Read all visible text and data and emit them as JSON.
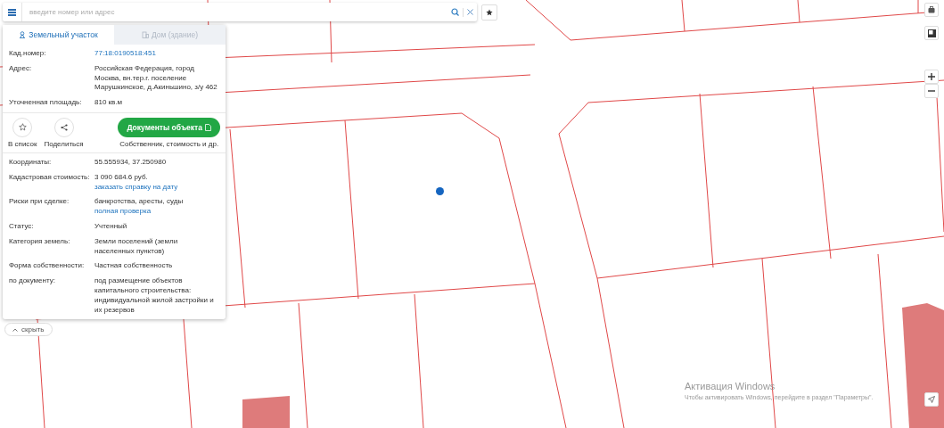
{
  "search": {
    "placeholder": "введите номер или адрес"
  },
  "tabs": [
    {
      "label": "Земельный участок",
      "selected": true
    },
    {
      "label": "Дом (здание)",
      "selected": false
    }
  ],
  "info_top": [
    {
      "label": "Кад.номер:",
      "value": "77:18:0190518:451",
      "kind": "link"
    },
    {
      "label": "Адрес:",
      "value": "Российская Федерация, город Москва, вн.тер.г. поселение Марушкинское, д.Акиньшино, з/у 462",
      "kind": "text"
    },
    {
      "label": "Уточненная площадь:",
      "value": "810 кв.м",
      "kind": "text"
    }
  ],
  "actions": {
    "favorite": "В список",
    "share": "Поделиться",
    "documents_button": "Документы объекта",
    "documents_caption": "Собственник, стоимость и др."
  },
  "info_bottom": [
    {
      "label": "Координаты:",
      "value": "55.555934, 37.250980"
    },
    {
      "label": "Кадастровая стоимость:",
      "value": "3 090 684.6 руб.",
      "link": "заказать справку на дату"
    },
    {
      "label": "Риски при сделке:",
      "value": "банкротства, аресты, суды",
      "link": "полная проверка"
    },
    {
      "label": "Статус:",
      "value": "Учтенный"
    },
    {
      "label": "Категория земель:",
      "value": "Земли поселений (земли населенных пунктов)"
    },
    {
      "label": "Форма собственности:",
      "value": "Частная собственность"
    },
    {
      "label": "по документу:",
      "value": "под размещение объектов капитального строительства: индивидуальной жилой застройки и их резервов"
    }
  ],
  "hide_button": "скрыть",
  "os_notice": {
    "title": "Активация Windows",
    "text": "Чтобы активировать Windows, перейдите в раздел \"Параметры\"."
  }
}
